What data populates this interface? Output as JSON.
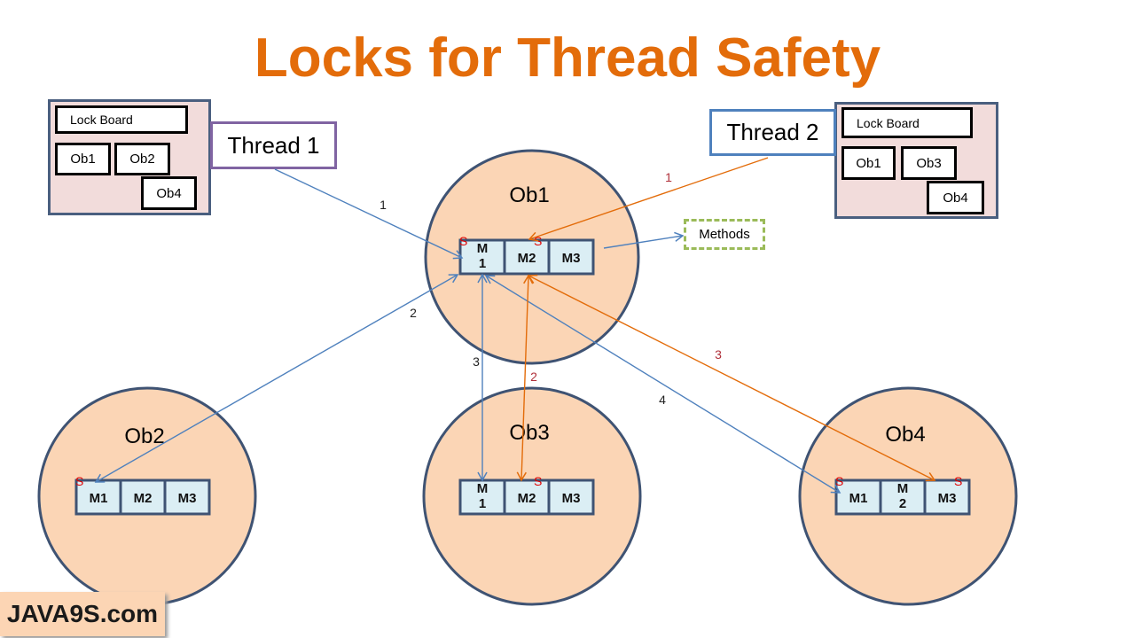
{
  "title": "Locks for Thread Safety",
  "colors": {
    "title": "#e36c0a",
    "object_fill": "#fbd5b5",
    "object_stroke": "#3f5373",
    "method_fill": "#dbeef4",
    "thread1_arrow": "#4f81bd",
    "thread2_arrow": "#e36c0a",
    "sync_marker": "#e00000",
    "lockboard_fill": "#f2dcdb",
    "methods_border": "#9bbb59"
  },
  "threads": [
    {
      "label": "Thread 1",
      "lock_board": {
        "title": "Lock Board",
        "held_locks": [
          "Ob1",
          "Ob2",
          "Ob4"
        ]
      }
    },
    {
      "label": "Thread 2",
      "lock_board": {
        "title": "Lock Board",
        "held_locks": [
          "Ob1",
          "Ob3",
          "Ob4"
        ]
      }
    }
  ],
  "objects": [
    {
      "id": "ob1",
      "label": "Ob1",
      "methods": [
        {
          "label": "M\n1",
          "sync": true
        },
        {
          "label": "M2",
          "sync": true
        },
        {
          "label": "M3",
          "sync": false
        }
      ]
    },
    {
      "id": "ob2",
      "label": "Ob2",
      "methods": [
        {
          "label": "M1",
          "sync": true
        },
        {
          "label": "M2",
          "sync": false
        },
        {
          "label": "M3",
          "sync": false
        }
      ]
    },
    {
      "id": "ob3",
      "label": "Ob3",
      "methods": [
        {
          "label": "M\n1",
          "sync": false
        },
        {
          "label": "M2",
          "sync": true
        },
        {
          "label": "M3",
          "sync": false
        }
      ]
    },
    {
      "id": "ob4",
      "label": "Ob4",
      "methods": [
        {
          "label": "M1",
          "sync": true
        },
        {
          "label": "M\n2",
          "sync": false
        },
        {
          "label": "M3",
          "sync": true
        }
      ]
    }
  ],
  "sync_marker": "S",
  "methods_callout": "Methods",
  "arrows": [
    {
      "thread": 1,
      "step": "1",
      "from": "Thread 1",
      "to": "Ob1.M1"
    },
    {
      "thread": 1,
      "step": "2",
      "from": "Ob1.M1",
      "to": "Ob2.M1"
    },
    {
      "thread": 1,
      "step": "3",
      "from": "Ob1.M1",
      "to": "Ob3.M1"
    },
    {
      "thread": 1,
      "step": "4",
      "from": "Ob1.M1",
      "to": "Ob4.M1"
    },
    {
      "thread": 2,
      "step": "1",
      "from": "Thread 2",
      "to": "Ob1.M2"
    },
    {
      "thread": 2,
      "step": "2",
      "from": "Ob1.M2",
      "to": "Ob3.M2"
    },
    {
      "thread": 2,
      "step": "3",
      "from": "Ob1.M2",
      "to": "Ob4.M3"
    }
  ],
  "logo": "JAVA9S.com"
}
